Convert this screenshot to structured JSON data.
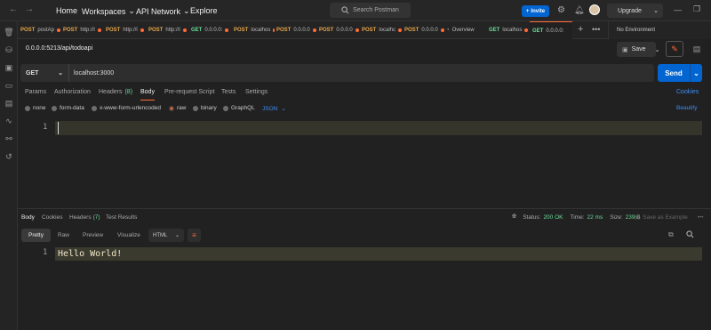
{
  "topbar": {
    "nav": [
      "Home",
      "Workspaces",
      "API Network",
      "Explore"
    ],
    "search_placeholder": "Search Postman",
    "invite_label": "Invite",
    "upgrade_label": "Upgrade"
  },
  "tabs": [
    {
      "method": "POST",
      "label": "postAp",
      "dot": true
    },
    {
      "method": "POST",
      "label": "http://l",
      "dot": true
    },
    {
      "method": "POST",
      "label": "http://l",
      "dot": true
    },
    {
      "method": "POST",
      "label": "http://l",
      "dot": true
    },
    {
      "method": "GET",
      "label": "0.0.0.0:",
      "dot": true
    },
    {
      "method": "POST",
      "label": "localhos",
      "dot": true
    },
    {
      "method": "POST",
      "label": "0.0.0.0",
      "dot": true
    },
    {
      "method": "POST",
      "label": "0.0.0.0",
      "dot": true
    },
    {
      "method": "POST",
      "label": "localhc",
      "dot": true
    },
    {
      "method": "POST",
      "label": "0.0.0.0",
      "dot": true
    },
    {
      "method": "",
      "label": "Overview",
      "dot": false
    },
    {
      "method": "GET",
      "label": "localhos",
      "dot": true
    },
    {
      "method": "GET",
      "label": "0.0.0.0:",
      "dot": false
    }
  ],
  "environment": "No Environment",
  "request": {
    "title": "0.0.0.0:5213/api/todoapi",
    "save_label": "Save",
    "method": "GET",
    "url": "localhost:3000",
    "send_label": "Send",
    "tabs": [
      "Params",
      "Authorization",
      "Headers",
      "(8)",
      "Body",
      "Pre-request Script",
      "Tests",
      "Settings"
    ],
    "cookies_label": "Cookies",
    "body_modes": [
      "none",
      "form-data",
      "x-www-form-urlencoded",
      "raw",
      "binary",
      "GraphQL"
    ],
    "raw_type": "JSON",
    "beautify_label": "Beautify",
    "editor_line": "1"
  },
  "response": {
    "tabs": [
      "Body",
      "Cookies",
      "Headers",
      "(7)",
      "Test Results"
    ],
    "status_label": "Status:",
    "status_value": "200 OK",
    "time_label": "Time:",
    "time_value": "22 ms",
    "size_label": "Size:",
    "size_value": "239 B",
    "save_example": "Save as Example",
    "formats": [
      "Pretty",
      "Raw",
      "Preview",
      "Visualize"
    ],
    "language": "HTML",
    "line_number": "1",
    "body_text": "Hello World!"
  },
  "colors": {
    "accent": "#ff6c37",
    "primary": "#0265d2",
    "get": "#6bdd9a",
    "post": "#e5a64a",
    "link": "#3d8ff5"
  }
}
